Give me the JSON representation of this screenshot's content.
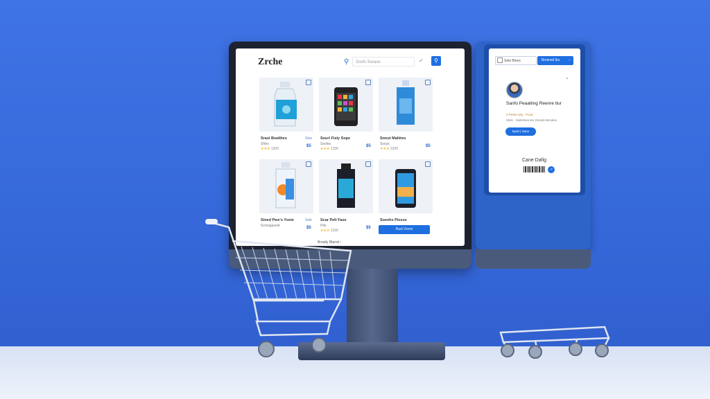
{
  "store": {
    "logo": "Zrche",
    "search_placeholder": "Ssofs  Sorace"
  },
  "products": [
    {
      "name": "Srasl Bealthes",
      "sub": "Shtrs",
      "rating_count": "1300",
      "price_top": "Stos",
      "price": "$5"
    },
    {
      "name": "Sourl Fisly Sope",
      "sub": "Ssolos",
      "rating_count": "1330",
      "price_top": "",
      "price": "$5"
    },
    {
      "name": "Sonut Mahhes",
      "sub": "Ssoys",
      "rating_count": "2335",
      "price_top": "",
      "price": "$5"
    },
    {
      "name": "Sined Pwe's Yoste",
      "sub": "Scresgasent",
      "rating_count": "",
      "price_top": "Sele",
      "price": "$5"
    },
    {
      "name": "Scar Pelt Fase",
      "sub": "Pds",
      "rating_count": "1330",
      "price_top": "",
      "price": "$5"
    },
    {
      "name": "Soeehs Piosse",
      "sub": "",
      "rating_count": "",
      "price_top": "",
      "price": ""
    }
  ],
  "grid": {
    "add_button": "Rusl Vnzre",
    "pager": "Broalty Blarrel"
  },
  "panel": {
    "input_value": "Sele Blees",
    "button_label": "Brosnsd Iks",
    "title": "Sanfo Peaalting Reenre tlur",
    "meta": "3 Pesle Arlg · Poud",
    "desc": "Stsls · Soiitslnes tes Stroole Bsnolen",
    "cta": "Bysb | Saoo",
    "code_label": "Cane Dafig"
  },
  "colors": {
    "accent": "#1f6fe0",
    "background": "#3567d8"
  }
}
